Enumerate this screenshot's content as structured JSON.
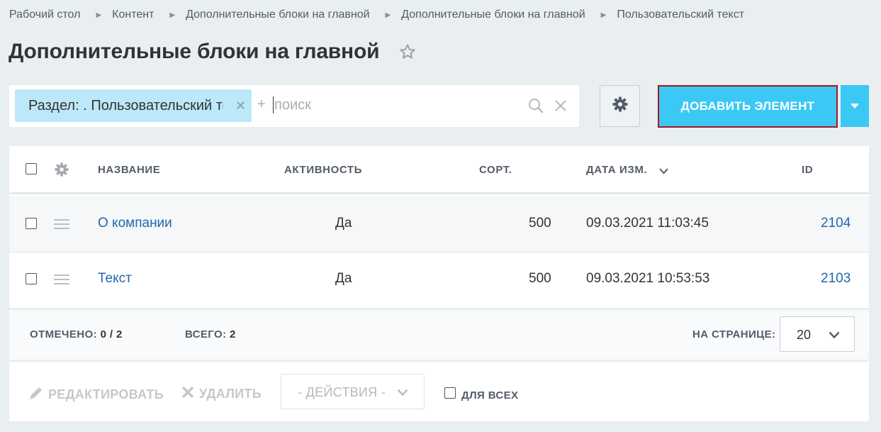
{
  "breadcrumbs": [
    "Рабочий стол",
    "Контент",
    "Дополнительные блоки на главной",
    "Дополнительные блоки на главной",
    "Пользовательский текст"
  ],
  "page_title": "Дополнительные блоки на главной",
  "filter": {
    "chip_label": "Раздел: . Пользовательский текст",
    "plus": "+",
    "placeholder": "поиск",
    "value": ""
  },
  "add_button_label": "ДОБАВИТЬ ЭЛЕМЕНТ",
  "table": {
    "columns": {
      "name": "НАЗВАНИЕ",
      "active": "АКТИВНОСТЬ",
      "sort": "СОРТ.",
      "date": "ДАТА ИЗМ.",
      "id": "ID"
    },
    "rows": [
      {
        "name": "О компании",
        "active": "Да",
        "sort": "500",
        "date": "09.03.2021 11:03:45",
        "id": "2104"
      },
      {
        "name": "Текст",
        "active": "Да",
        "sort": "500",
        "date": "09.03.2021 10:53:53",
        "id": "2103"
      }
    ]
  },
  "footer": {
    "marked_label": "ОТМЕЧЕНО:",
    "marked_value": "0 / 2",
    "total_label": "ВСЕГО:",
    "total_value": "2",
    "per_page_label": "НА СТРАНИЦЕ:",
    "per_page_value": "20"
  },
  "actions": {
    "edit": "РЕДАКТИРОВАТЬ",
    "delete": "УДАЛИТЬ",
    "select": "- ДЕЙСТВИЯ -",
    "for_all": "ДЛЯ ВСЕХ"
  },
  "colors": {
    "accent": "#3bc8f5",
    "chip": "#bce8f9",
    "link": "#2067b0",
    "highlight_border": "#a51921"
  }
}
